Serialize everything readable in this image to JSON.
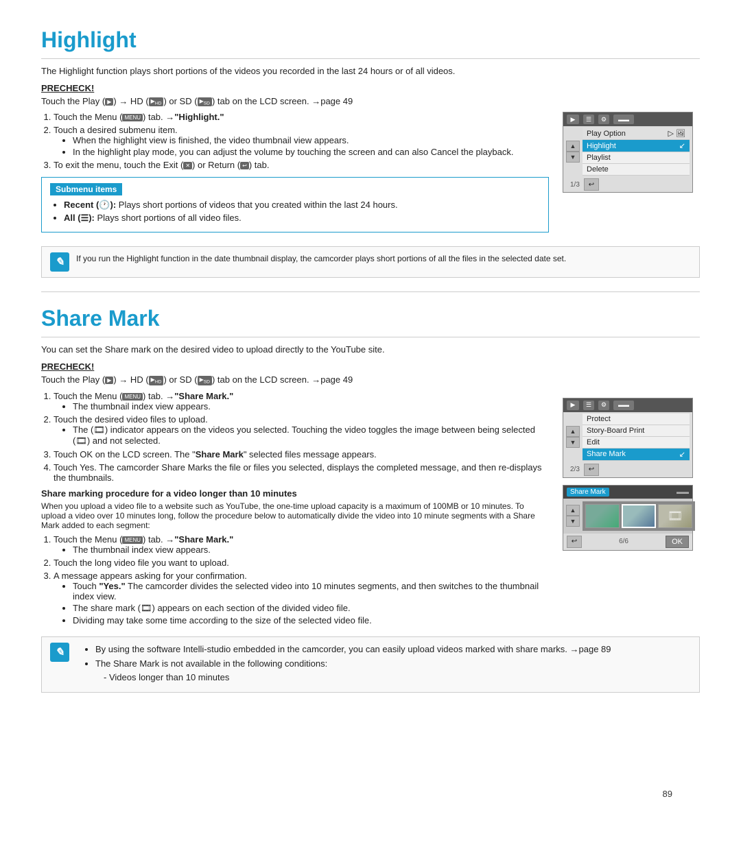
{
  "highlight_section": {
    "title": "Highlight",
    "intro": "The Highlight function plays short portions of the videos you recorded in the last 24 hours or of all videos.",
    "precheck_label": "PRECHECK!",
    "precheck_line": "Touch the Play (▶) → HD (▶HD) or SD (▶SD) tab on the LCD screen. →page 49",
    "steps": [
      {
        "num": "1.",
        "text": "Touch the Menu (MENU) tab. →\"Highlight.\""
      },
      {
        "num": "2.",
        "text": "Touch a desired submenu item.",
        "bullets": [
          "When the highlight view is finished, the video thumbnail view appears.",
          "In the highlight play mode, you can adjust the volume by touching the screen and can also Cancel the playback."
        ]
      },
      {
        "num": "3.",
        "text": "To exit the menu, touch the Exit (✕) or Return (↩) tab."
      }
    ],
    "submenu_title": "Submenu items",
    "submenu_items": [
      "Recent (🕐): Plays short portions of videos that you created within the last 24 hours.",
      "All (☰): Plays short portions of all video files."
    ],
    "note": "If you run the Highlight function in the date thumbnail display, the camcorder plays short portions of all the files in the selected date set.",
    "menu_items": [
      {
        "label": "Play Option",
        "highlighted": false,
        "extra": "▷ 🖼"
      },
      {
        "label": "Highlight",
        "highlighted": true,
        "extra": ""
      },
      {
        "label": "Playlist",
        "highlighted": false,
        "extra": ""
      },
      {
        "label": "Delete",
        "highlighted": false,
        "extra": ""
      }
    ],
    "menu_counter": "1/3"
  },
  "share_mark_section": {
    "title": "Share Mark",
    "intro": "You can set the Share mark on the desired video to upload directly to the YouTube site.",
    "precheck_label": "PRECHECK!",
    "precheck_line": "Touch the Play (▶) → HD (▶HD) or SD (▶SD) tab on the LCD screen. →page 49",
    "steps": [
      {
        "num": "1.",
        "text": "Touch the Menu (MENU) tab. →\"Share Mark.\"",
        "bullets": [
          "The thumbnail index view appears."
        ]
      },
      {
        "num": "2.",
        "text": "Touch the desired video files to upload.",
        "bullets": [
          "The (🎞) indicator appears on the videos you selected. Touching the video toggles the image between being selected (🎞) and not selected."
        ]
      },
      {
        "num": "3.",
        "text": "Touch OK on the LCD screen. The \"Share Mark\" selected files message appears."
      },
      {
        "num": "4.",
        "text": "Touch Yes. The camcorder Share Marks the file or files you selected, displays the completed message, and then re-displays the thumbnails."
      }
    ],
    "share_marking_title": "Share marking procedure for a video longer than 10 minutes",
    "share_marking_text": "When you upload a video file to a website such as YouTube, the one-time upload capacity is a maximum of 100MB or 10 minutes. To upload a video over 10 minutes long, follow the procedure below to automatically divide the video into 10 minute segments with a Share Mark added to each segment:",
    "share_steps": [
      {
        "num": "1.",
        "text": "Touch the Menu (MENU) tab. →\"Share Mark.\"",
        "bullets": [
          "The thumbnail index view appears."
        ]
      },
      {
        "num": "2.",
        "text": "Touch the long video file you want to upload."
      },
      {
        "num": "3.",
        "text": "A message appears asking for your confirmation.",
        "bullets": [
          "Touch \"Yes.\" The camcorder divides the selected video into 10 minutes segments, and then switches to the thumbnail index view.",
          "The share mark (🎞) appears on each section of the divided video file.",
          "Dividing may take some time according to the size of the selected video file."
        ]
      }
    ],
    "menu_items": [
      {
        "label": "Protect",
        "highlighted": false
      },
      {
        "label": "Story-Board Print",
        "highlighted": false
      },
      {
        "label": "Edit",
        "highlighted": false
      },
      {
        "label": "Share Mark",
        "highlighted": true
      }
    ],
    "menu_counter": "2/3",
    "share_mark_counter": "6/6",
    "notes": [
      "By using the software Intelli-studio embedded in the camcorder, you can easily upload videos marked with share marks. →page 89",
      "The Share Mark is not available in the following conditions:",
      "- Videos longer than 10 minutes"
    ]
  },
  "page_number": "89"
}
